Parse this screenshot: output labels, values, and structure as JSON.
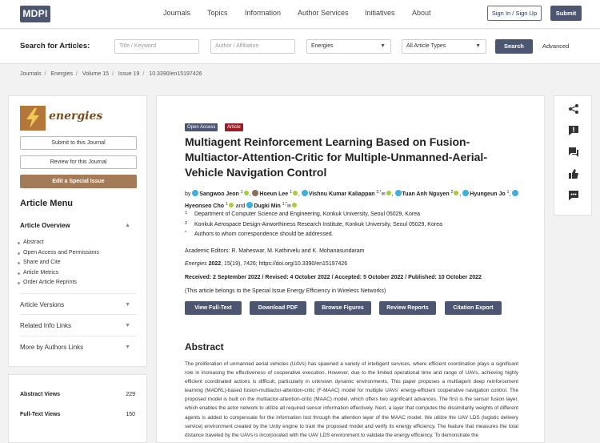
{
  "nav": {
    "logo": "MDPI",
    "items": [
      "Journals",
      "Topics",
      "Information",
      "Author Services",
      "Initiatives",
      "About"
    ],
    "signin": "Sign In / Sign Up",
    "submit": "Submit"
  },
  "search": {
    "label": "Search for Articles:",
    "keyword_placeholder": "Title / Keyword",
    "author_placeholder": "Author / Affiliation",
    "journal_value": "Energies",
    "type_value": "All Article Types",
    "button": "Search",
    "advanced": "Advanced"
  },
  "breadcrumb": [
    "Journals",
    "Energies",
    "Volume 15",
    "Issue 19",
    "10.3390/en15197426"
  ],
  "sidebar": {
    "journal_name": "energies",
    "submit_btn": "Submit to this Journal",
    "review_btn": "Review for this Journal",
    "special_btn": "Edit a Special Issue",
    "menu_title": "Article Menu",
    "overview_title": "Article Overview",
    "overview_items": [
      "Abstract",
      "Open Access and Permissions",
      "Share and Cite",
      "Article Metrics",
      "Order Article Reprints"
    ],
    "sections": [
      "Article Versions",
      "Related Info Links",
      "More by Authors Links"
    ]
  },
  "views": {
    "abstract_label": "Abstract Views",
    "abstract_value": "229",
    "fulltext_label": "Full-Text Views",
    "fulltext_value": "150"
  },
  "article": {
    "badge_open": "Open Access",
    "badge_type": "Article",
    "title": "Multiagent Reinforcement Learning Based on Fusion-Multiactor-Attention-Critic for Multiple-Unmanned-Aerial-Vehicle Navigation Control",
    "by": "by",
    "authors": [
      {
        "name": "Sangwoo Jeon",
        "sup": "1"
      },
      {
        "name": "Hoeun Lee",
        "sup": "1"
      },
      {
        "name": "Vishnu Kumar Kaliappan",
        "sup": "2,*"
      },
      {
        "name": "Tuan Anh Nguyen",
        "sup": "2"
      },
      {
        "name": "Hyungeun Jo",
        "sup": "1"
      },
      {
        "name": "Hyeonseo Cho",
        "sup": "1"
      },
      {
        "name": "Dugki Min",
        "sup": "1,*"
      }
    ],
    "and": "and",
    "affiliations": [
      {
        "n": "1",
        "text": "Department of Computer Science and Engineering, Konkuk University, Seoul 05029, Korea"
      },
      {
        "n": "2",
        "text": "Konkuk Aerospace Design-Airworthiness Research Institute, Konkuk University, Seoul 05029, Korea"
      },
      {
        "n": "*",
        "text": "Authors to whom correspondence should be addressed."
      }
    ],
    "editors": "Academic Editors: R. Maheswar, M. Kathirvelu and K. Mohanasundaram",
    "citation_journal": "Energies",
    "citation_year": "2022",
    "citation_rest": ", 15(19), 7426; https://doi.org/10.3390/en15197426",
    "dates": "Received: 2 September 2022 / Revised: 4 October 2022 / Accepted: 5 October 2022 / Published: 10 October 2022",
    "special_issue": "(This article belongs to the Special Issue Energy Efficiency in Wireless Networks)",
    "buttons": [
      "View Full-Text",
      "Download PDF",
      "Browse Figures",
      "Review Reports",
      "Citation Export"
    ],
    "abstract_title": "Abstract",
    "abstract_text": "The proliferation of unmanned aerial vehicles (UAVs) has spawned a variety of intelligent services, where efficient coordination plays a significant role in increasing the effectiveness of cooperative execution. However, due to the limited operational time and range of UAVs, achieving highly efficient coordinated actions is difficult, particularly in unknown dynamic environments. This paper proposes a multiagent deep reinforcement learning (MADRL)-based fusion-multiactor-attention-critic (F-MAAC) model for multiple UAVs' energy-efficient cooperative navigation control. The proposed model is built on the multiactor-attention-critic (MAAC) model, which offers two significant advances. The first is the sensor fusion layer, which enables the actor network to utilize all required sensor information effectively. Next, a layer that computes the dissimilarity weights of different agents is added to compensate for the information lost through the attention layer of the MAAC model. We utilize the UAV LDS (logistic delivery service) environment created by the Unity engine to train the proposed model and verify its energy efficiency. The feature that measures the total distance traveled by the UAVs is incorporated with the UAV LDS environment to validate the energy efficiency. To demonstrate the"
  },
  "right_icons": [
    "share-icon",
    "report-icon",
    "comment-icon",
    "like-icon",
    "chat-icon"
  ],
  "colors": {
    "primary": "#4d5670",
    "special": "#a47b58",
    "badge_red": "#9c1d27",
    "badge_dark": "#4d5670"
  }
}
